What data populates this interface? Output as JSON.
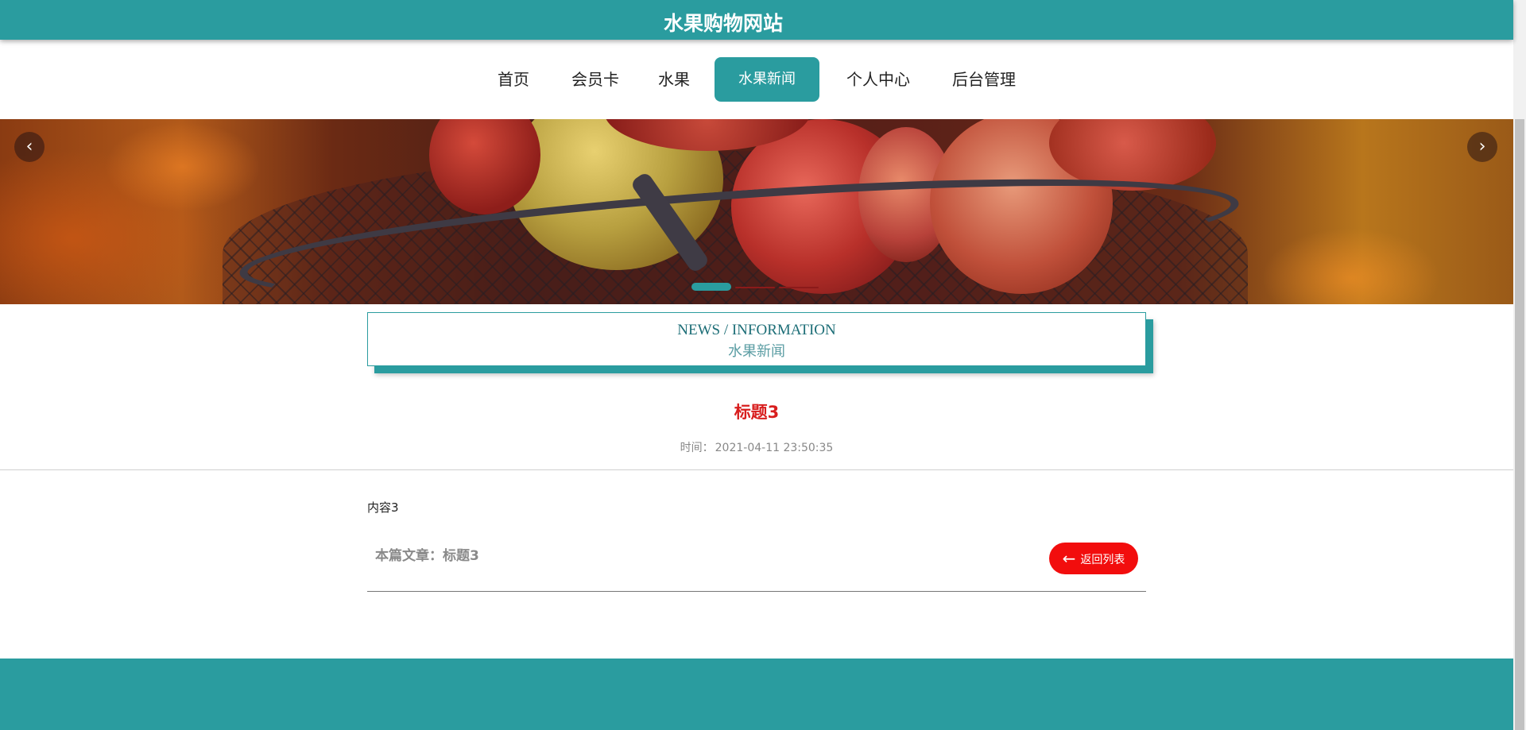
{
  "header": {
    "title": "水果购物网站"
  },
  "nav": {
    "items": [
      {
        "label": "首页"
      },
      {
        "label": "会员卡"
      },
      {
        "label": "水果"
      },
      {
        "label": "水果新闻",
        "active": true
      },
      {
        "label": "个人中心"
      },
      {
        "label": "后台管理"
      }
    ]
  },
  "banner": {
    "prev_icon": "‹",
    "next_icon": "›",
    "slide_count": 3,
    "active_slide": 1,
    "colors": {
      "active_dot": "#2a9c9f",
      "inactive_dot": "#8b1a1a"
    }
  },
  "section": {
    "title_en": "NEWS / INFORMATION",
    "title_cn": "水果新闻"
  },
  "article": {
    "title": "标题3",
    "time_label": "时间：",
    "time_value": "2021-04-11 23:50:35",
    "content": "内容3",
    "current_label": "本篇文章：",
    "current_title": "标题3",
    "back_label": "返回列表",
    "back_icon": "←"
  },
  "colors": {
    "accent": "#2a9c9f",
    "title_red": "#d81e1e",
    "button_red": "#f20d0d"
  }
}
